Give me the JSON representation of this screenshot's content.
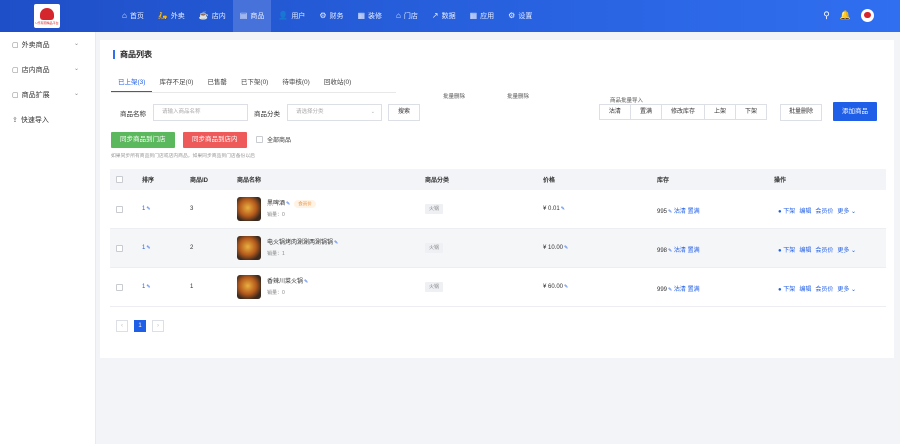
{
  "logo": {
    "text": "U乐有圈精品平台"
  },
  "nav": [
    {
      "icon": "⌂",
      "label": "首页"
    },
    {
      "icon": "🛵",
      "label": "外卖"
    },
    {
      "icon": "☕",
      "label": "店内"
    },
    {
      "icon": "▤",
      "label": "商品"
    },
    {
      "icon": "👤",
      "label": "用户"
    },
    {
      "icon": "⚙",
      "label": "财务"
    },
    {
      "icon": "▦",
      "label": "装修"
    },
    {
      "icon": "⌂",
      "label": "门店"
    },
    {
      "icon": "↗",
      "label": "数据"
    },
    {
      "icon": "▦",
      "label": "应用"
    },
    {
      "icon": "⚙",
      "label": "设置"
    }
  ],
  "sidebar": [
    {
      "label": "外卖商品"
    },
    {
      "label": "店内商品"
    },
    {
      "label": "商品扩展"
    },
    {
      "label": "快速导入"
    }
  ],
  "page": {
    "title": "商品列表"
  },
  "tabs": [
    {
      "label": "已上架(3)"
    },
    {
      "label": "库存不足(0)"
    },
    {
      "label": "已售罄"
    },
    {
      "label": "已下架(0)"
    },
    {
      "label": "待审核(0)"
    },
    {
      "label": "回收站(0)"
    }
  ],
  "stray": {
    "a": "批量删除",
    "b": "批量删除",
    "c": "商品批量导入"
  },
  "batch": {
    "clear": "沽清",
    "restock": "置满",
    "stock": "修改库存",
    "up": "上架",
    "down": "下架"
  },
  "actions": {
    "batch_delete": "批量删除",
    "add": "添加商品"
  },
  "filter": {
    "name_label": "商品名称",
    "name_placeholder": "请输入商品名称",
    "cat_label": "商品分类",
    "cat_placeholder": "请选择分类",
    "search": "搜索"
  },
  "sync": {
    "store": "同步商品到门店",
    "dine": "同步商品到店内",
    "all": "全部商品"
  },
  "hint": "如果同步所有商品到门店或店内商品，如果同步商品到门店备份以后",
  "columns": {
    "sort": "排序",
    "id": "商品ID",
    "name": "商品名称",
    "category": "商品分类",
    "price": "价格",
    "stock": "库存",
    "ops": "操作"
  },
  "rows": [
    {
      "sort": "1",
      "id": "3",
      "name": "黑啤酒",
      "member": "会员价",
      "sales": "销量：0",
      "category": "火锅",
      "price": "¥ 0.01",
      "stock": "995"
    },
    {
      "sort": "1",
      "id": "2",
      "name": "电火锅烤肉涮涮两涮锅锅",
      "member": "",
      "sales": "销量：1",
      "category": "火锅",
      "price": "¥ 10.00",
      "stock": "998"
    },
    {
      "sort": "1",
      "id": "1",
      "name": "香辣川菜火锅",
      "member": "",
      "sales": "销量：0",
      "category": "火锅",
      "price": "¥ 60.00",
      "stock": "999"
    }
  ],
  "row_ops": {
    "clear": "沽清",
    "restock": "置满",
    "down": "下架",
    "edit": "编辑",
    "member_price": "会员价",
    "more": "更多"
  },
  "pager": {
    "prev": "‹",
    "current": "1",
    "next": "›"
  }
}
